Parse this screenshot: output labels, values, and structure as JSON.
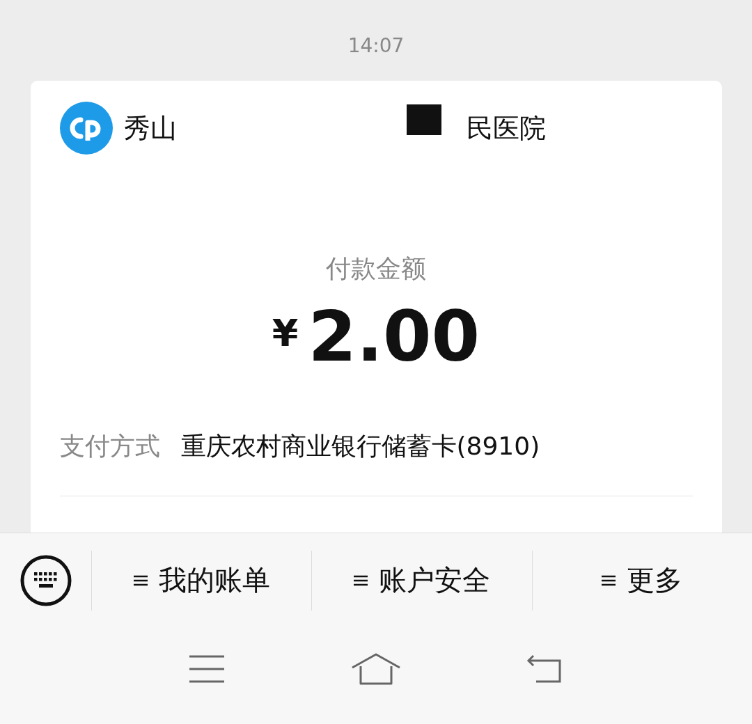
{
  "time": "14:07",
  "merchant": {
    "name_start": "秀山",
    "name_end": "民医院",
    "redacted": true
  },
  "payment": {
    "amount_label": "付款金额",
    "currency": "¥",
    "amount": "2.00",
    "method_label": "支付方式",
    "method_value": "重庆农村商业银行储蓄卡(8910)"
  },
  "menu": [
    {
      "label": "我的账单"
    },
    {
      "label": "账户安全"
    },
    {
      "label": "更多"
    }
  ]
}
